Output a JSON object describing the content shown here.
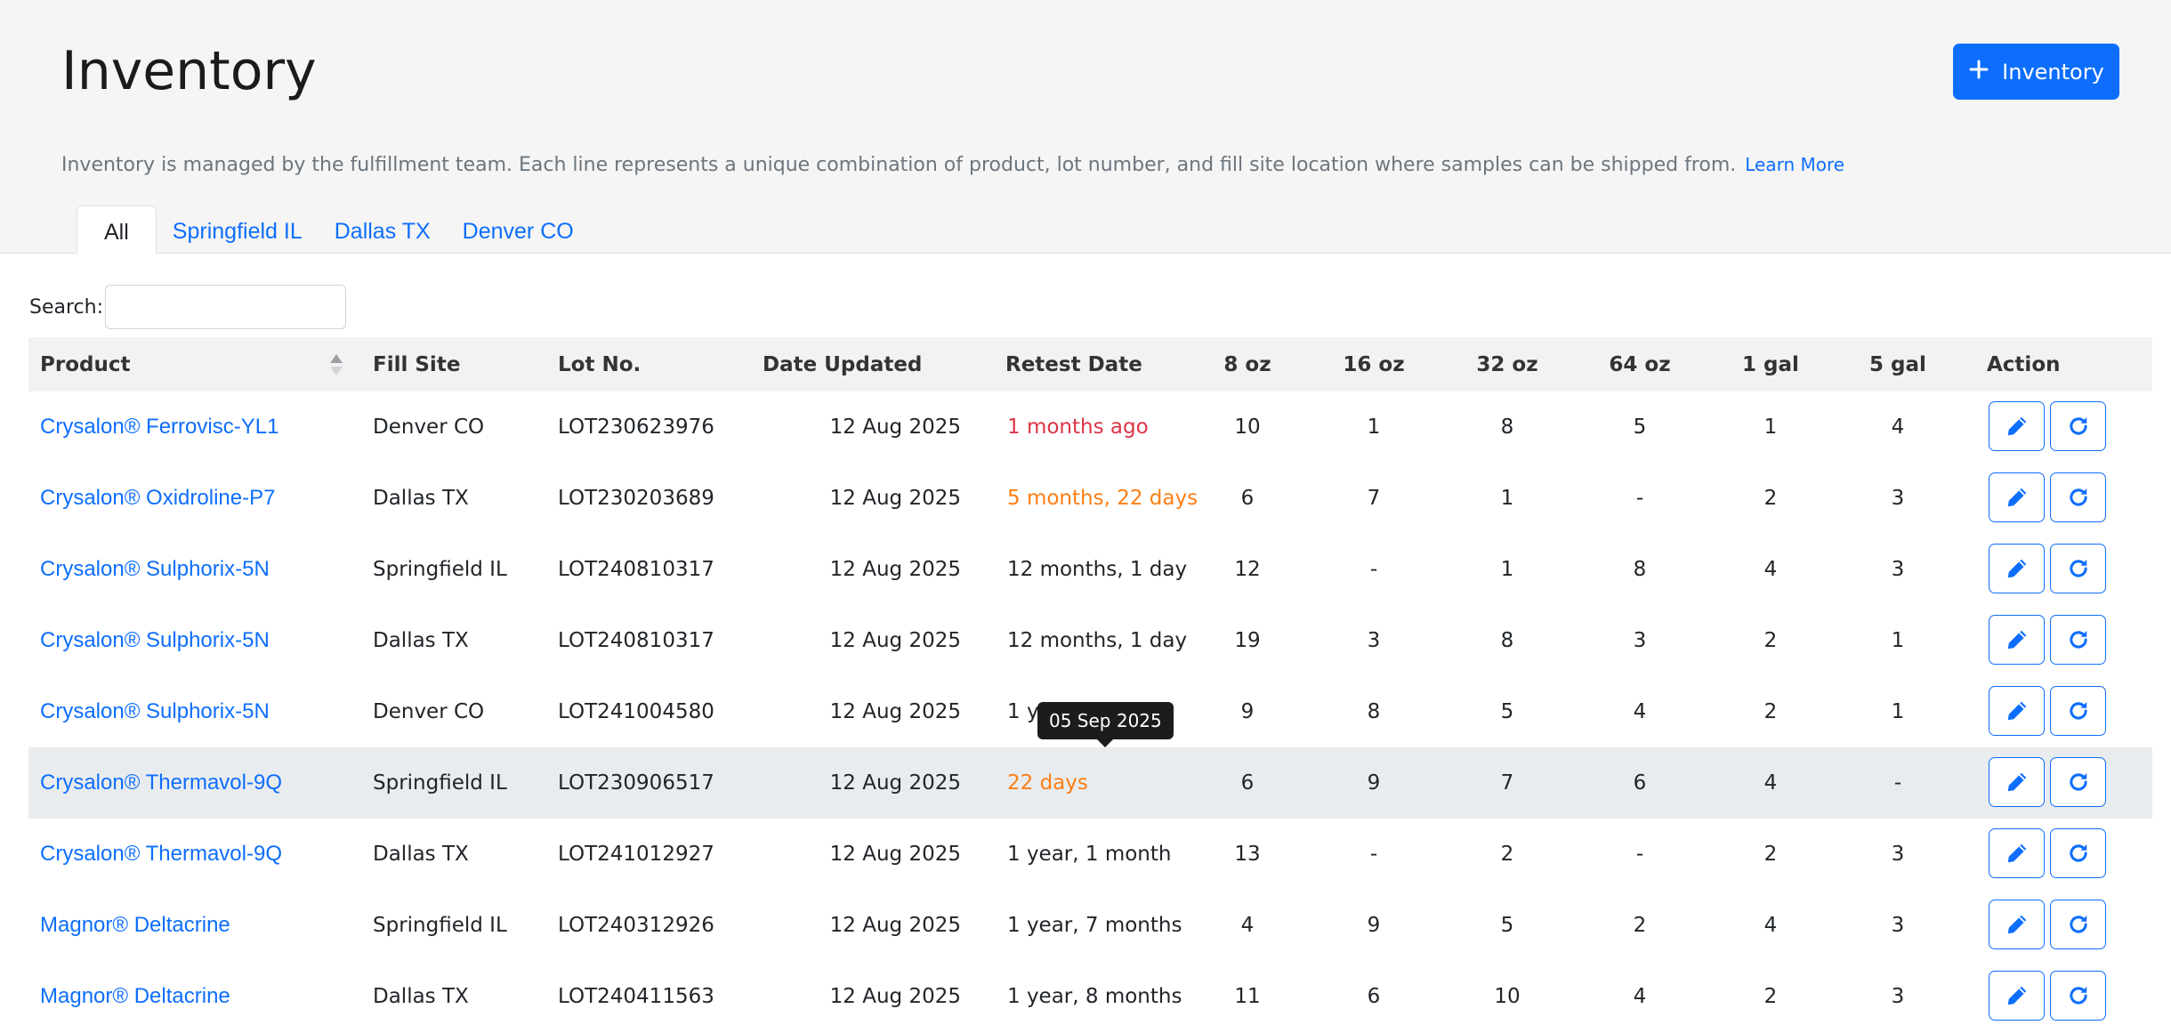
{
  "page": {
    "title": "Inventory",
    "add_button_label": "Inventory",
    "description": "Inventory is managed by the fulfillment team. Each line represents a unique combination of product, lot number, and fill site location where samples can be shipped from.",
    "learn_more": "Learn More"
  },
  "tabs": [
    {
      "label": "All",
      "active": true
    },
    {
      "label": "Springfield IL",
      "active": false
    },
    {
      "label": "Dallas TX",
      "active": false
    },
    {
      "label": "Denver CO",
      "active": false
    }
  ],
  "search": {
    "label": "Search:",
    "value": "",
    "placeholder": ""
  },
  "table": {
    "headers": [
      "Product",
      "Fill Site",
      "Lot No.",
      "Date Updated",
      "Retest Date",
      "8 oz",
      "16 oz",
      "32 oz",
      "64 oz",
      "1 gal",
      "5 gal",
      "Action"
    ],
    "rows": [
      {
        "product": "Crysalon® Ferrovisc-YL1",
        "site": "Denver CO",
        "lot": "LOT230623976",
        "updated": "12 Aug 2025",
        "retest": "1 months ago",
        "retest_status": "expired",
        "oz8": "10",
        "oz16": "1",
        "oz32": "8",
        "oz64": "5",
        "gal1": "1",
        "gal5": "4"
      },
      {
        "product": "Crysalon® Oxidroline-P7",
        "site": "Dallas TX",
        "lot": "LOT230203689",
        "updated": "12 Aug 2025",
        "retest": "5 months, 22 days",
        "retest_status": "warning",
        "oz8": "6",
        "oz16": "7",
        "oz32": "1",
        "oz64": "-",
        "gal1": "2",
        "gal5": "3"
      },
      {
        "product": "Crysalon® Sulphorix-5N",
        "site": "Springfield IL",
        "lot": "LOT240810317",
        "updated": "12 Aug 2025",
        "retest": "12 months, 1 day",
        "retest_status": "ok",
        "oz8": "12",
        "oz16": "-",
        "oz32": "1",
        "oz64": "8",
        "gal1": "4",
        "gal5": "3"
      },
      {
        "product": "Crysalon® Sulphorix-5N",
        "site": "Dallas TX",
        "lot": "LOT240810317",
        "updated": "12 Aug 2025",
        "retest": "12 months, 1 day",
        "retest_status": "ok",
        "oz8": "19",
        "oz16": "3",
        "oz32": "8",
        "oz64": "3",
        "gal1": "2",
        "gal5": "1"
      },
      {
        "product": "Crysalon® Sulphorix-5N",
        "site": "Denver CO",
        "lot": "LOT241004580",
        "updated": "12 Aug 2025",
        "retest": "1 y",
        "retest_status": "ok",
        "oz8": "9",
        "oz16": "8",
        "oz32": "5",
        "oz64": "4",
        "gal1": "2",
        "gal5": "1"
      },
      {
        "product": "Crysalon® Thermavol-9Q",
        "site": "Springfield IL",
        "lot": "LOT230906517",
        "updated": "12 Aug 2025",
        "retest": "22 days",
        "retest_status": "warning",
        "oz8": "6",
        "oz16": "9",
        "oz32": "7",
        "oz64": "6",
        "gal1": "4",
        "gal5": "-",
        "highlighted": true
      },
      {
        "product": "Crysalon® Thermavol-9Q",
        "site": "Dallas TX",
        "lot": "LOT241012927",
        "updated": "12 Aug 2025",
        "retest": "1 year, 1 month",
        "retest_status": "ok",
        "oz8": "13",
        "oz16": "-",
        "oz32": "2",
        "oz64": "-",
        "gal1": "2",
        "gal5": "3"
      },
      {
        "product": "Magnor® Deltacrine",
        "site": "Springfield IL",
        "lot": "LOT240312926",
        "updated": "12 Aug 2025",
        "retest": "1 year, 7 months",
        "retest_status": "ok",
        "oz8": "4",
        "oz16": "9",
        "oz32": "5",
        "oz64": "2",
        "gal1": "4",
        "gal5": "3"
      },
      {
        "product": "Magnor® Deltacrine",
        "site": "Dallas TX",
        "lot": "LOT240411563",
        "updated": "12 Aug 2025",
        "retest": "1 year, 8 months",
        "retest_status": "ok",
        "oz8": "11",
        "oz16": "6",
        "oz32": "10",
        "oz64": "4",
        "gal1": "2",
        "gal5": "3"
      }
    ]
  },
  "tooltip": {
    "text": "05 Sep 2025"
  },
  "colors": {
    "primary": "#0d6efd",
    "expired": "#dc3545",
    "warning": "#fd7e14",
    "row_highlight": "#e9ecef"
  },
  "icons": {
    "add": "plus-icon",
    "edit": "pencil-icon",
    "refresh": "refresh-icon",
    "sort": "sort-icon"
  }
}
